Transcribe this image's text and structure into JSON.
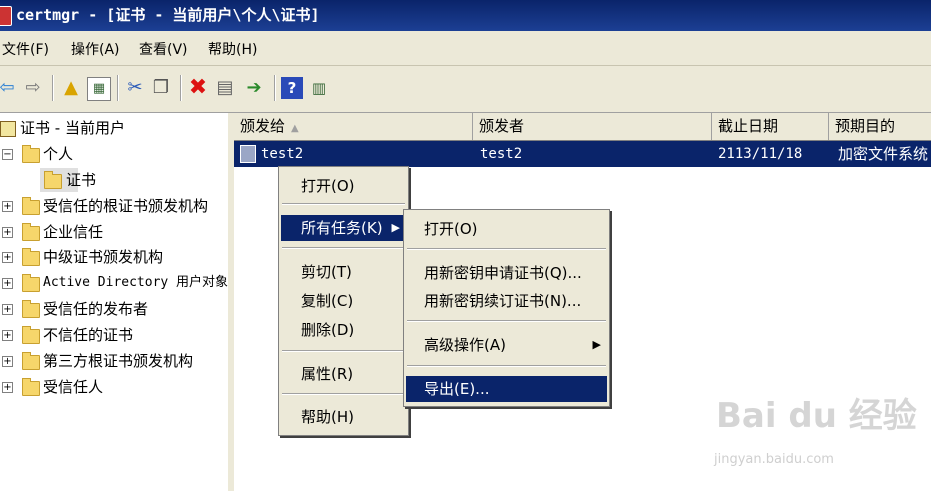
{
  "window": {
    "title": "certmgr - [证书 - 当前用户\\个人\\证书]"
  },
  "menubar": {
    "items": [
      "文件(F)",
      "操作(A)",
      "查看(V)",
      "帮助(H)"
    ]
  },
  "toolbar": {
    "icons": [
      "back-icon",
      "forward-icon",
      "up-folder-icon",
      "show-hide-tree-icon",
      "cut-icon",
      "copy-icon",
      "delete-icon",
      "properties-icon",
      "export-list-icon",
      "help-icon",
      "console-tree-icon"
    ]
  },
  "tree": {
    "root": "证书 - 当前用户",
    "personal": "个人",
    "certificates": "证书",
    "items": [
      "受信任的根证书颁发机构",
      "企业信任",
      "中级证书颁发机构",
      "Active Directory 用户对象",
      "受信任的发布者",
      "不信任的证书",
      "第三方根证书颁发机构",
      "受信任人"
    ]
  },
  "list": {
    "columns": [
      "颁发给",
      "颁发者",
      "截止日期",
      "预期目的"
    ],
    "rows": [
      {
        "issued_to": "test2",
        "issued_by": "test2",
        "expiration": "2113/11/18",
        "purpose": "加密文件系统"
      }
    ]
  },
  "context_menu": {
    "open": "打开(O)",
    "all_tasks": "所有任务(K)",
    "cut": "剪切(T)",
    "copy": "复制(C)",
    "delete": "删除(D)",
    "properties": "属性(R)",
    "help": "帮助(H)"
  },
  "submenu": {
    "open": "打开(O)",
    "request_new_key": "用新密钥申请证书(Q)...",
    "renew_new_key": "用新密钥续订证书(N)...",
    "advanced": "高级操作(A)",
    "export": "导出(E)..."
  },
  "watermark": {
    "brand": "Bai du 经验",
    "url": "jingyan.baidu.com"
  },
  "colors": {
    "selection": "#0a246a",
    "titlebar": "#0a246a",
    "chrome": "#ece9d8"
  }
}
